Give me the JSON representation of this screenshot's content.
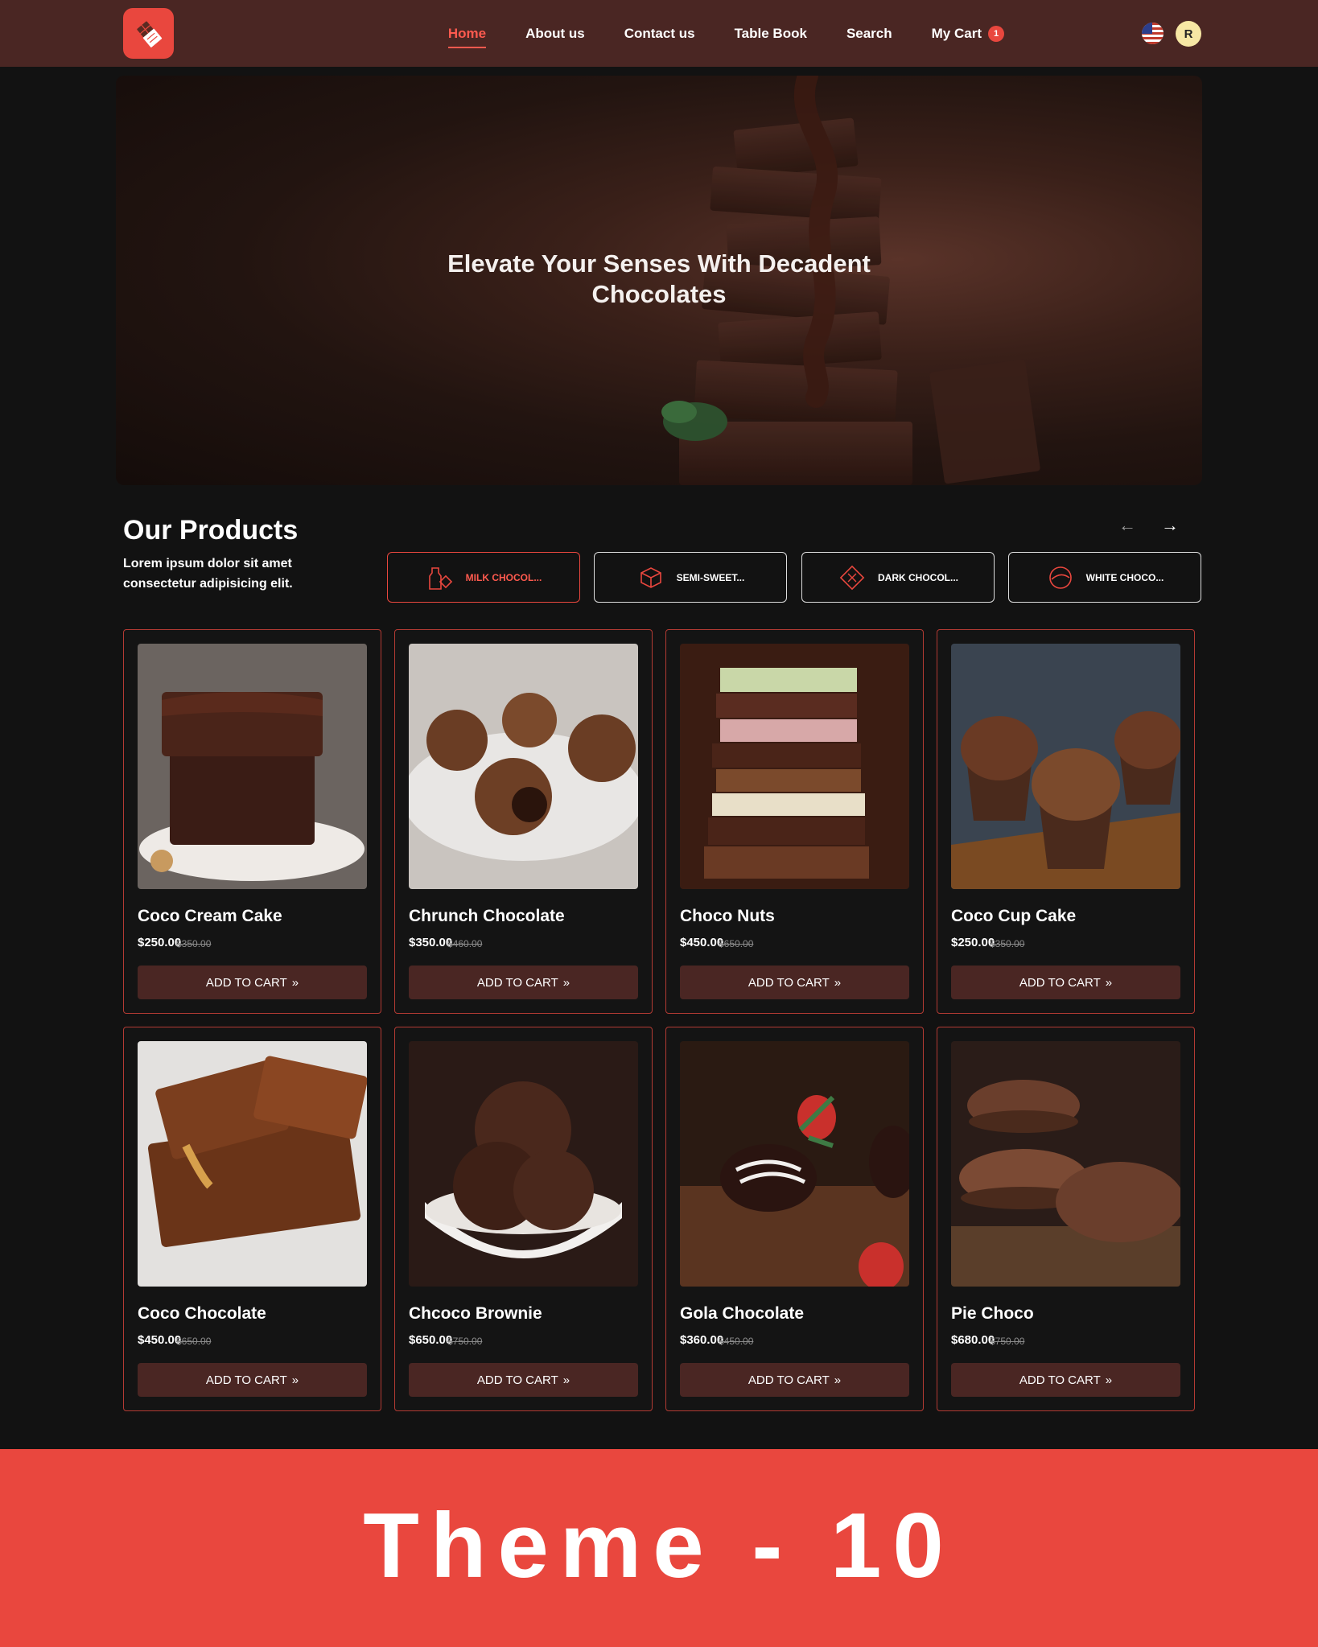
{
  "nav": {
    "items": [
      {
        "label": "Home",
        "active": true
      },
      {
        "label": "About us"
      },
      {
        "label": "Contact us"
      },
      {
        "label": "Table Book"
      },
      {
        "label": "Search"
      },
      {
        "label": "My Cart"
      }
    ],
    "cart_count": "1",
    "avatar_initial": "R"
  },
  "hero": {
    "title_line1": "Elevate Your Senses With Decadent",
    "title_line2": "Chocolates"
  },
  "products": {
    "title": "Our Products",
    "description": "Lorem ipsum dolor sit amet consectetur adipisicing elit.",
    "categories": [
      {
        "label": "MILK CHOCOL...",
        "icon": "milk-chocolate-icon",
        "active": true
      },
      {
        "label": "SEMI-SWEET...",
        "icon": "semi-sweet-icon"
      },
      {
        "label": "DARK CHOCOL...",
        "icon": "dark-chocolate-icon"
      },
      {
        "label": "WHITE CHOCO...",
        "icon": "white-chocolate-icon"
      }
    ],
    "items": [
      {
        "name": "Coco Cream Cake",
        "price": "$250.00",
        "old_price": "$350.00"
      },
      {
        "name": "Chrunch Chocolate",
        "price": "$350.00",
        "old_price": "$460.00"
      },
      {
        "name": "Choco Nuts",
        "price": "$450.00",
        "old_price": "$650.00"
      },
      {
        "name": "Coco Cup Cake",
        "price": "$250.00",
        "old_price": "$350.00"
      },
      {
        "name": "Coco Chocolate",
        "price": "$450.00",
        "old_price": "$650.00"
      },
      {
        "name": "Chcoco Brownie",
        "price": "$650.00",
        "old_price": "$750.00"
      },
      {
        "name": "Gola Chocolate",
        "price": "$360.00",
        "old_price": "$450.00"
      },
      {
        "name": "Pie Choco",
        "price": "$680.00",
        "old_price": "$750.00"
      }
    ],
    "add_to_cart_label": "ADD TO CART"
  },
  "banner": {
    "text": "Theme - 10"
  },
  "colors": {
    "accent": "#e9473e",
    "header_bg": "#4a2623",
    "page_bg": "#121212"
  }
}
